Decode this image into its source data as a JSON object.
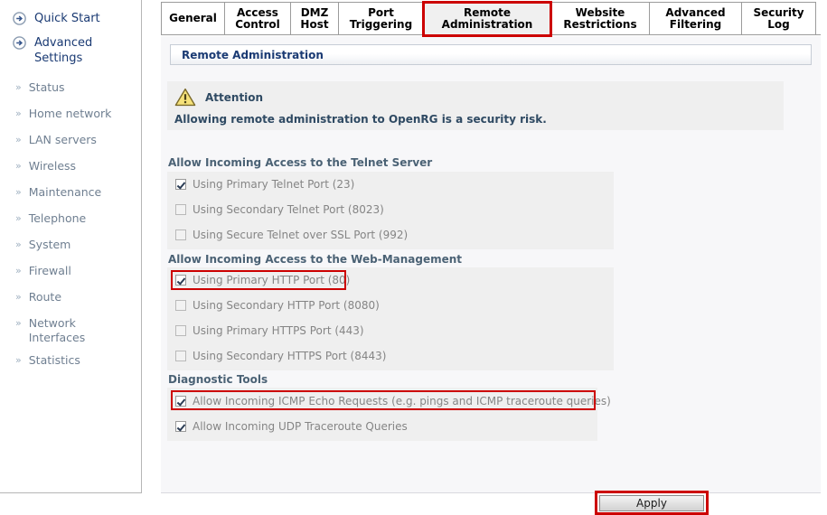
{
  "sidebar": {
    "primary_items": [
      {
        "label": "Quick Start",
        "icon": "arrow-circle-icon"
      },
      {
        "label": "Advanced Settings",
        "icon": "arrow-circle-icon"
      }
    ],
    "secondary_items": [
      {
        "label": "Status",
        "icon": "chevron-double-right-icon"
      },
      {
        "label": "Home network",
        "icon": "chevron-double-right-icon"
      },
      {
        "label": "LAN servers",
        "icon": "chevron-double-right-icon"
      },
      {
        "label": "Wireless",
        "icon": "chevron-double-right-icon"
      },
      {
        "label": "Maintenance",
        "icon": "chevron-double-right-icon"
      },
      {
        "label": "Telephone",
        "icon": "chevron-double-right-icon"
      },
      {
        "label": "System",
        "icon": "chevron-double-right-icon"
      },
      {
        "label": "Firewall",
        "icon": "chevron-double-right-icon"
      },
      {
        "label": "Route",
        "icon": "chevron-double-right-icon"
      },
      {
        "label": "Network Interfaces",
        "icon": "chevron-double-right-icon"
      },
      {
        "label": "Statistics",
        "icon": "chevron-double-right-icon"
      }
    ]
  },
  "tabs": [
    {
      "label": "General",
      "active": false,
      "highlighted": false
    },
    {
      "label": "Access\nControl",
      "active": false,
      "highlighted": false
    },
    {
      "label": "DMZ\nHost",
      "active": false,
      "highlighted": false
    },
    {
      "label": "Port\nTriggering",
      "active": false,
      "highlighted": false
    },
    {
      "label": "Remote\nAdministration",
      "active": true,
      "highlighted": true
    },
    {
      "label": "Website\nRestrictions",
      "active": false,
      "highlighted": false
    },
    {
      "label": "Advanced\nFiltering",
      "active": false,
      "highlighted": false
    },
    {
      "label": "Security\nLog",
      "active": false,
      "highlighted": false
    }
  ],
  "page": {
    "header_title": "Remote Administration",
    "attention": {
      "icon": "warning-triangle-icon",
      "title": "Attention",
      "message": "Allowing remote administration to OpenRG is a security risk."
    },
    "sections": [
      {
        "title": "Allow Incoming Access to the Telnet Server",
        "options": [
          {
            "label": "Using Primary Telnet Port (23)",
            "checked": true,
            "highlighted": false
          },
          {
            "label": "Using Secondary Telnet Port (8023)",
            "checked": false,
            "highlighted": false
          },
          {
            "label": "Using Secure Telnet over SSL Port (992)",
            "checked": false,
            "highlighted": false
          }
        ]
      },
      {
        "title": "Allow Incoming Access to the Web-Management",
        "options": [
          {
            "label": "Using Primary HTTP Port (80)",
            "checked": true,
            "highlighted": true
          },
          {
            "label": "Using Secondary HTTP Port (8080)",
            "checked": false,
            "highlighted": false
          },
          {
            "label": "Using Primary HTTPS Port (443)",
            "checked": false,
            "highlighted": false
          },
          {
            "label": "Using Secondary HTTPS Port (8443)",
            "checked": false,
            "highlighted": false
          }
        ]
      },
      {
        "title": "Diagnostic Tools",
        "options": [
          {
            "label": "Allow Incoming ICMP Echo Requests (e.g. pings and ICMP traceroute queries)",
            "checked": true,
            "highlighted": true
          },
          {
            "label": "Allow Incoming UDP Traceroute Queries",
            "checked": true,
            "highlighted": false
          }
        ]
      }
    ],
    "apply_label": "Apply"
  },
  "colors": {
    "highlight_red": "#cc0000",
    "header_blue": "#1a3a73",
    "section_heading": "#4b6275",
    "panel_gray": "#efefef",
    "content_bg": "#f7f7f9"
  }
}
